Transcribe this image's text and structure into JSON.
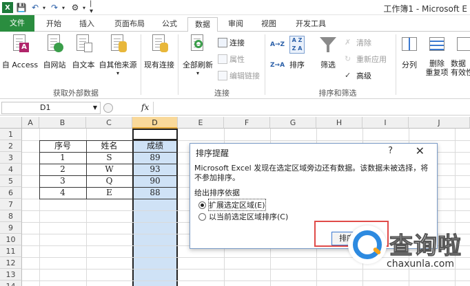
{
  "window": {
    "title": "工作簿1 - Microsoft E"
  },
  "quick_access": {
    "undo_icon": "undo-icon",
    "redo_icon": "redo-icon",
    "save_icon": "save-icon",
    "excel_icon": "excel-logo-icon"
  },
  "tabs": [
    {
      "label": "文件",
      "kind": "file"
    },
    {
      "label": "开始"
    },
    {
      "label": "插入"
    },
    {
      "label": "页面布局"
    },
    {
      "label": "公式"
    },
    {
      "label": "数据",
      "active": true
    },
    {
      "label": "审阅"
    },
    {
      "label": "视图"
    },
    {
      "label": "开发工具"
    }
  ],
  "ribbon": {
    "get_external": {
      "group_label": "获取外部数据",
      "buttons": [
        "自 Access",
        "自网站",
        "自文本",
        "自其他来源",
        "现有连接"
      ]
    },
    "connections": {
      "group_label": "连接",
      "refresh_all": "全部刷新",
      "connections": "连接",
      "properties": "属性",
      "edit_links": "编辑链接"
    },
    "sort_filter": {
      "group_label": "排序和筛选",
      "sort_asc": "A→Z",
      "sort_desc": "Z→A",
      "sort": "排序",
      "filter": "筛选",
      "clear": "清除",
      "reapply": "重新应用",
      "advanced": "高级"
    },
    "data_tools": {
      "split": "分列",
      "remove_dup_line1": "删除",
      "remove_dup_line2": "重复项",
      "validation_line1": "数据",
      "validation_line2": "有效性"
    }
  },
  "formula_bar": {
    "name_box": "D1",
    "fx": "fx",
    "value": ""
  },
  "sheet": {
    "columns": [
      "A",
      "B",
      "C",
      "D",
      "E",
      "F",
      "G",
      "H",
      "I",
      "J"
    ],
    "rows": [
      "1",
      "2",
      "3",
      "4",
      "5",
      "6",
      "7",
      "8",
      "9",
      "10",
      "11",
      "12",
      "13",
      "14"
    ],
    "selected_column": "D",
    "table": {
      "headers": [
        "序号",
        "姓名",
        "成绩"
      ],
      "rows": [
        [
          "1",
          "S",
          "89"
        ],
        [
          "2",
          "W",
          "93"
        ],
        [
          "3",
          "Q",
          "90"
        ],
        [
          "4",
          "E",
          "88"
        ]
      ]
    }
  },
  "dialog": {
    "title": "排序提醒",
    "help": "?",
    "close": "✕",
    "message": "Microsoft Excel 发现在选定区域旁边还有数据。该数据未被选择，将不参加排序。",
    "subheading": "给出排序依据",
    "option_expand": "扩展选定区域(E)",
    "option_current": "以当前选定区域排序(C)",
    "selected_option": "expand",
    "sort_button": "排序"
  },
  "watermark": {
    "text": "查询啦",
    "domain": "chaxunla.com"
  }
}
